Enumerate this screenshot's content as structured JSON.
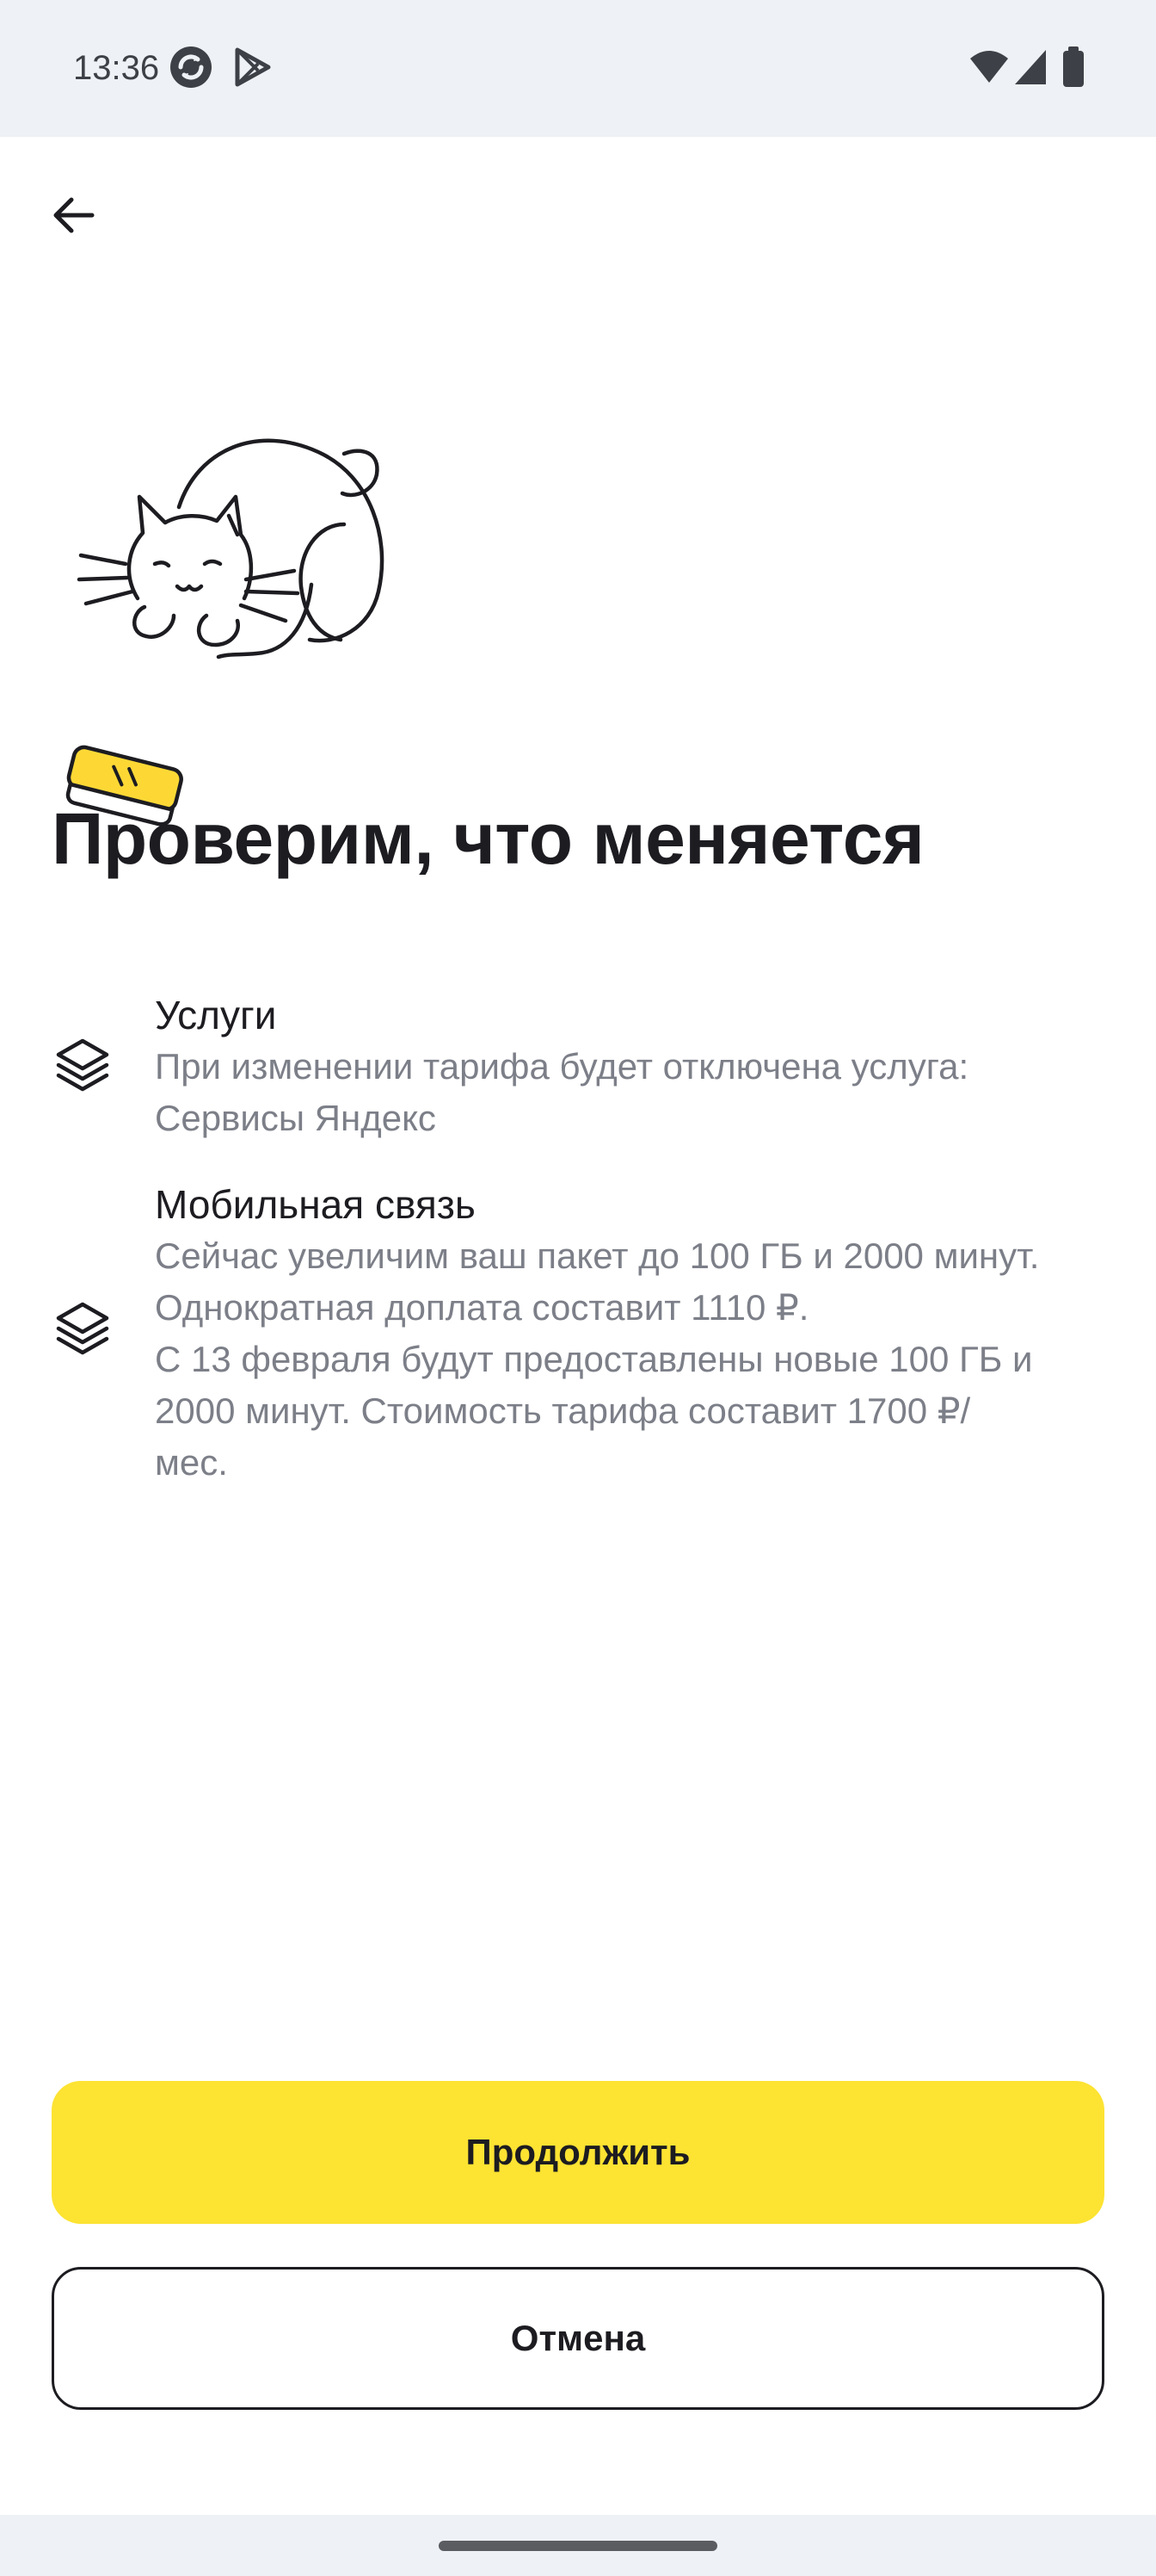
{
  "status_bar": {
    "time": "13:36",
    "icons": [
      "sync-app-icon",
      "play-store-icon",
      "wifi-icon",
      "signal-icon",
      "battery-icon"
    ]
  },
  "header": {
    "back_icon": "arrow-left-icon"
  },
  "illustration": {
    "name": "cat-with-phone-illustration",
    "accent_color": "#fdd835"
  },
  "page": {
    "title": "Проверим, что меняется"
  },
  "changes": [
    {
      "icon": "layers-icon",
      "heading": "Услуги",
      "lines": [
        "При изменении тарифа будет отключена услуга:",
        "Сервисы Яндекс"
      ]
    },
    {
      "icon": "layers-icon",
      "heading": "Мобильная связь",
      "lines": [
        "Сейчас увеличим ваш пакет до 100 ГБ и 2000 минут.",
        "Однократная доплата составит 1110 ₽.",
        "С 13 февраля будут предоставлены новые 100 ГБ и",
        "2000 минут. Стоимость тарифа составит 1700 ₽/",
        "мес."
      ]
    }
  ],
  "actions": {
    "continue_label": "Продолжить",
    "cancel_label": "Отмена"
  },
  "colors": {
    "accent": "#fde332",
    "text_primary": "#1c1c21",
    "text_secondary": "#7c7f88",
    "system_bar": "#eef1f5"
  }
}
